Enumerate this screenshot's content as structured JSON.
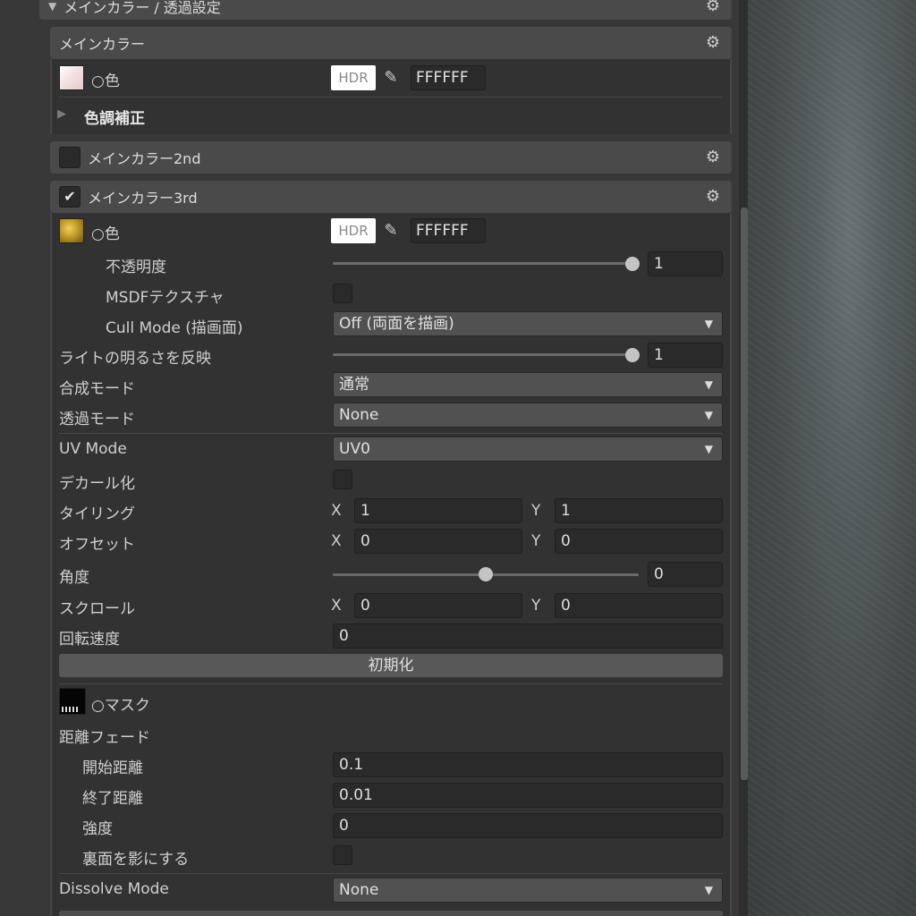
{
  "section_title": "メインカラー / 透過設定",
  "main_color": {
    "header": "メインカラー",
    "color_label": "○色",
    "hdr_label": "HDR",
    "hex_value": "FFFFFF",
    "color_adjust_label": "色調補正"
  },
  "main_color_2nd": {
    "header": "メインカラー2nd",
    "enabled": false
  },
  "main_color_3rd": {
    "header": "メインカラー3rd",
    "enabled": true,
    "color_label": "○色",
    "hdr_label": "HDR",
    "hex_value": "FFFFFF",
    "opacity_label": "不透明度",
    "opacity_value": "1",
    "msdf_label": "MSDFテクスチャ",
    "cull_mode_label": "Cull Mode (描画面)",
    "cull_mode_value": "Off (両面を描画)",
    "light_label": "ライトの明るさを反映",
    "light_value": "1",
    "blend_label": "合成モード",
    "blend_value": "通常",
    "transparency_label": "透過モード",
    "transparency_value": "None",
    "uv_mode_label": "UV Mode",
    "uv_mode_value": "UV0",
    "decal_label": "デカール化",
    "tiling_label": "タイリング",
    "tiling_x": "1",
    "tiling_y": "1",
    "offset_label": "オフセット",
    "offset_x": "0",
    "offset_y": "0",
    "angle_label": "角度",
    "angle_value": "0",
    "scroll_label": "スクロール",
    "scroll_x": "0",
    "scroll_y": "0",
    "rotation_speed_label": "回転速度",
    "rotation_speed_value": "0",
    "reset_button": "初期化",
    "mask_label": "○マスク",
    "distance_fade_label": "距離フェード",
    "fade_start_label": "開始距離",
    "fade_start_value": "0.1",
    "fade_end_label": "終了距離",
    "fade_end_value": "0.01",
    "strength_label": "強度",
    "strength_value": "0",
    "backface_shadow_label": "裏面を影にする",
    "dissolve_label": "Dissolve Mode",
    "dissolve_value": "None"
  },
  "axis_x": "X",
  "axis_y": "Y",
  "icons": {
    "gear": "gear-icon",
    "eyedropper": "eyedropper-icon",
    "foldout": "triangle-right-icon",
    "check": "checkmark-icon",
    "dropdown": "triangle-down-icon"
  }
}
